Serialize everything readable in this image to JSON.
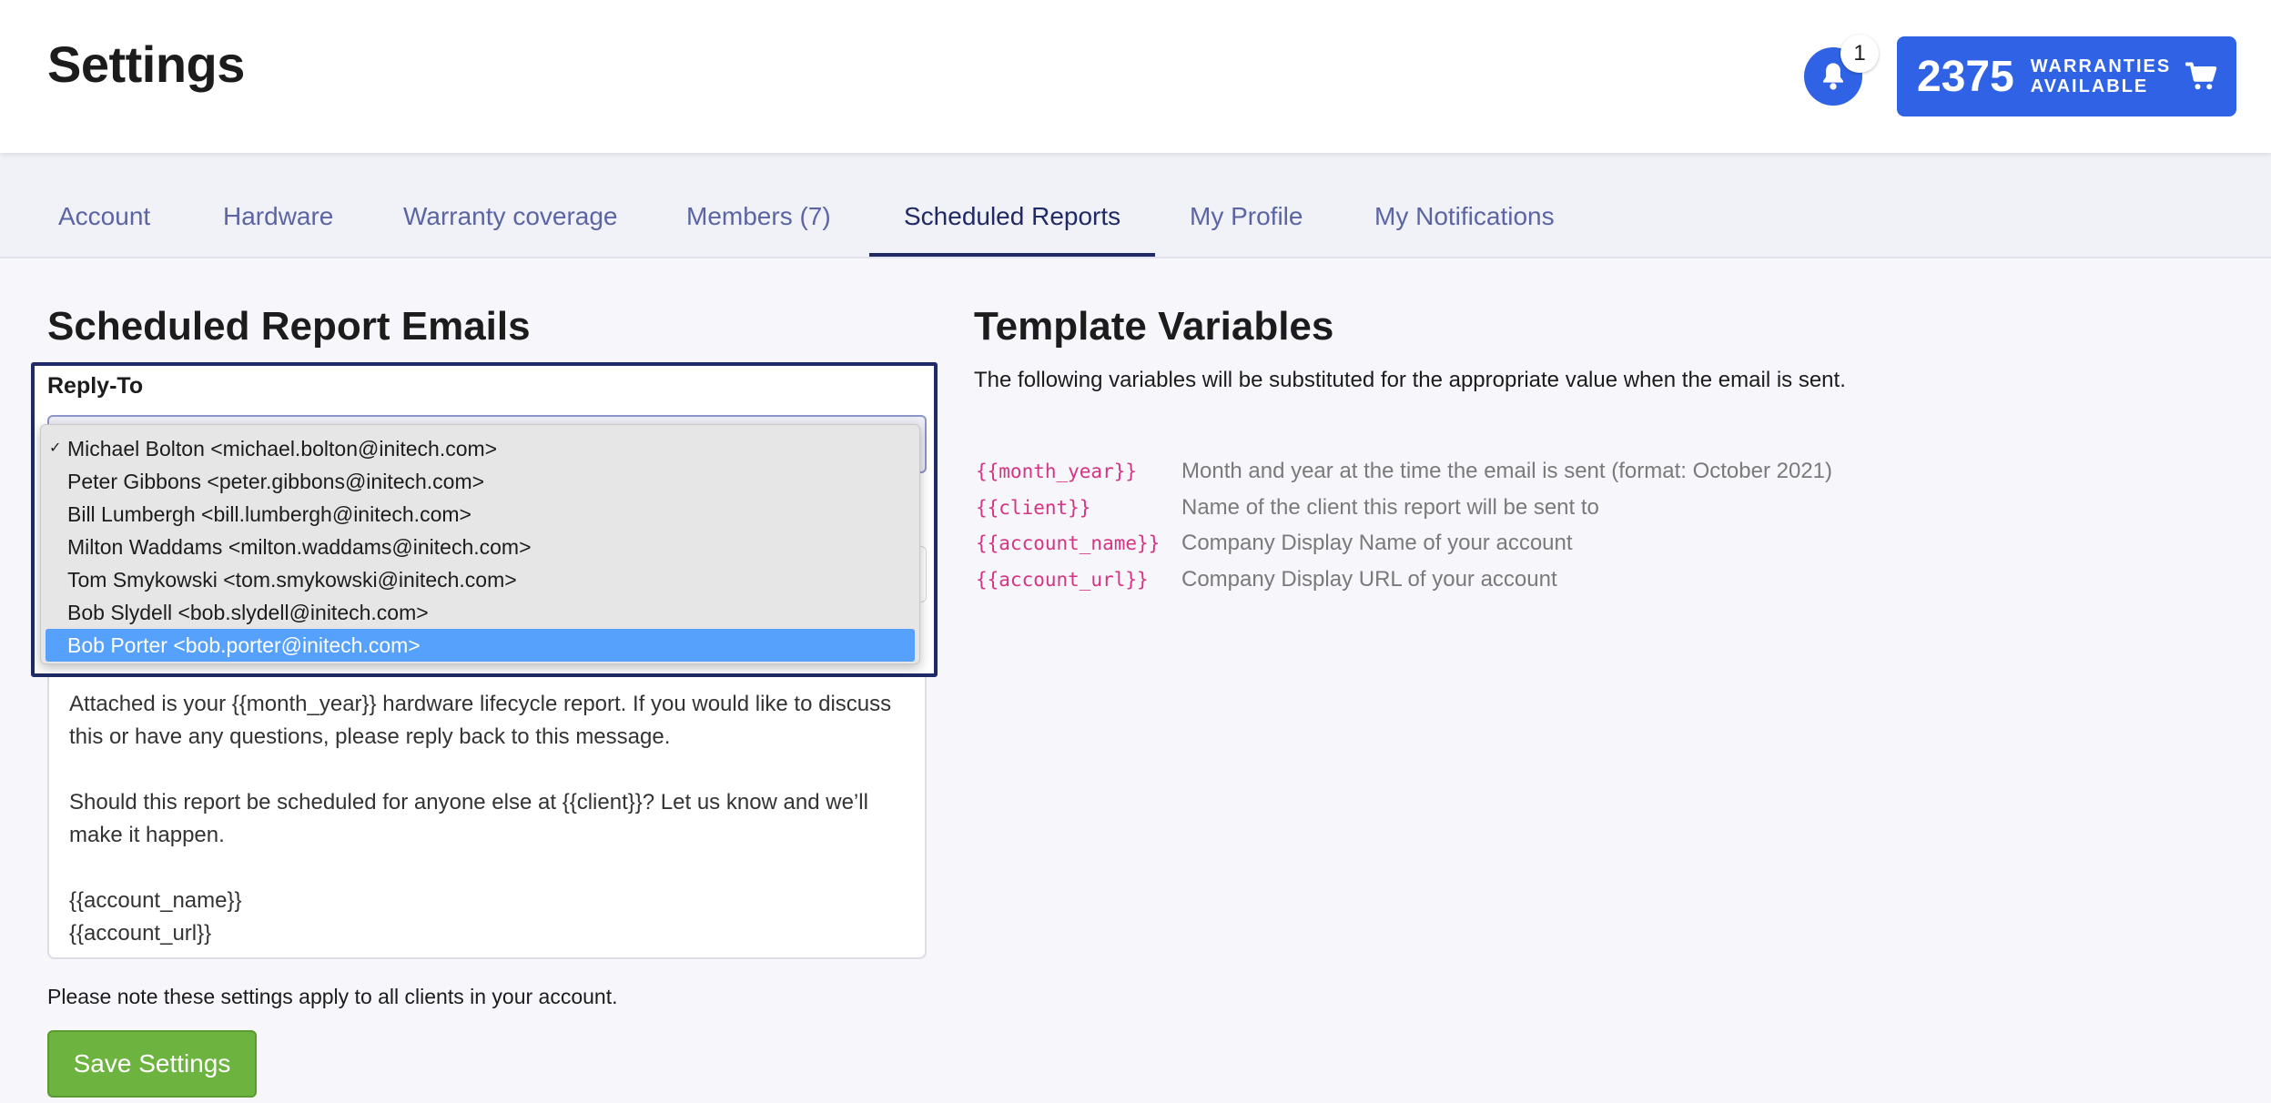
{
  "header": {
    "title": "Settings",
    "notification_count": "1",
    "warranties": {
      "count": "2375",
      "label": "WARRANTIES AVAILABLE"
    }
  },
  "tabs": [
    {
      "label": "Account"
    },
    {
      "label": "Hardware"
    },
    {
      "label": "Warranty coverage"
    },
    {
      "label": "Members (7)"
    },
    {
      "label": "Scheduled Reports",
      "active": true
    },
    {
      "label": "My Profile"
    },
    {
      "label": "My Notifications"
    }
  ],
  "left": {
    "title": "Scheduled Report Emails",
    "reply_to_label": "Reply-To",
    "reply_to_options": [
      "Michael Bolton <michael.bolton@initech.com>",
      "Peter Gibbons <peter.gibbons@initech.com>",
      "Bill Lumbergh <bill.lumbergh@initech.com>",
      "Milton Waddams <milton.waddams@initech.com>",
      "Tom Smykowski <tom.smykowski@initech.com>",
      "Bob Slydell <bob.slydell@initech.com>",
      "Bob Porter <bob.porter@initech.com>"
    ],
    "checked_option": "Michael Bolton <michael.bolton@initech.com>",
    "highlighted_option": "Bob Porter <bob.porter@initech.com>",
    "body": {
      "p1": "Attached is your {{month_year}} hardware lifecycle report. If you would like to discuss this or have any questions, please reply back to this message.",
      "p2": "Should this report be scheduled for anyone else at {{client}}? Let us know and we’ll make it happen.",
      "p3_line1": "{{account_name}}",
      "p3_line2": "{{account_url}}"
    },
    "note": "Please note these settings apply to all clients in your account.",
    "save_label": "Save Settings"
  },
  "right": {
    "title": "Template Variables",
    "description": "The following variables will be substituted for the appropriate value when the email is sent.",
    "variables": [
      {
        "code": "{{month_year}}",
        "desc": "Month and year at the time the email is sent (format: October 2021)"
      },
      {
        "code": "{{client}}",
        "desc": "Name of the client this report will be sent to"
      },
      {
        "code": "{{account_name}}",
        "desc": "Company Display Name of your account"
      },
      {
        "code": "{{account_url}}",
        "desc": "Company Display URL of your account"
      }
    ]
  },
  "colors": {
    "accent_blue": "#2f62e4",
    "tab_active": "#1f2a66",
    "save_green": "#6db33f",
    "code_pink": "#d63384",
    "dropdown_highlight": "#56a1fb"
  },
  "icons": {
    "bell": "bell-icon",
    "cart": "cart-icon",
    "check": "checkmark-icon"
  }
}
